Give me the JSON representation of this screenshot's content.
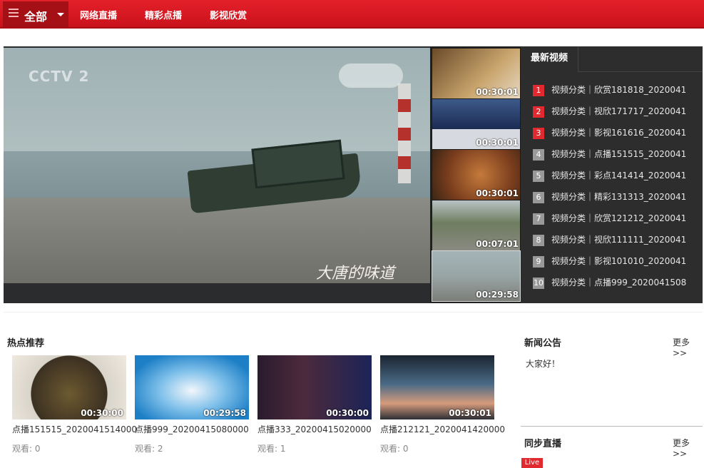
{
  "nav": {
    "all_label": "全部",
    "links": [
      "网络直播",
      "精彩点播",
      "影视欣赏"
    ]
  },
  "player": {
    "channel_logo": "CCTV 2",
    "program_title": "大唐的味道"
  },
  "thumbs": [
    {
      "duration": "00:30:01"
    },
    {
      "duration": "00:30:01"
    },
    {
      "duration": "00:30:01"
    },
    {
      "duration": "00:07:01"
    },
    {
      "duration": "00:29:58"
    }
  ],
  "latest": {
    "tab": "最新视频",
    "items": [
      {
        "num": "1",
        "text": "视频分类｜欣赏181818_2020041"
      },
      {
        "num": "2",
        "text": "视频分类｜视欣171717_2020041"
      },
      {
        "num": "3",
        "text": "视频分类｜影视161616_2020041"
      },
      {
        "num": "4",
        "text": "视频分类｜点播151515_2020041"
      },
      {
        "num": "5",
        "text": "视频分类｜彩点141414_2020041"
      },
      {
        "num": "6",
        "text": "视频分类｜精彩131313_2020041"
      },
      {
        "num": "7",
        "text": "视频分类｜欣赏121212_2020041"
      },
      {
        "num": "8",
        "text": "视频分类｜视欣111111_2020041"
      },
      {
        "num": "9",
        "text": "视频分类｜影视101010_2020041"
      },
      {
        "num": "10",
        "text": "视频分类｜点播999_2020041508"
      }
    ]
  },
  "hot": {
    "title": "热点推荐",
    "cards": [
      {
        "title": "点播151515_2020041514000",
        "views": "观看: 0",
        "duration": "00:30:00"
      },
      {
        "title": "点播999_20200415080000",
        "views": "观看: 2",
        "duration": "00:29:58"
      },
      {
        "title": "点播333_20200415020000",
        "views": "观看: 1",
        "duration": "00:30:00"
      },
      {
        "title": "点播212121_2020041420000",
        "views": "观看: 0",
        "duration": "00:30:01"
      }
    ]
  },
  "news": {
    "title": "新闻公告",
    "more": "更多>>",
    "body": "大家好！"
  },
  "sync": {
    "title": "同步直播",
    "more": "更多>>",
    "live_badge": "Live"
  },
  "colors": {
    "brand_red": "#d7181f",
    "panel_dark": "#2d2d2d"
  }
}
